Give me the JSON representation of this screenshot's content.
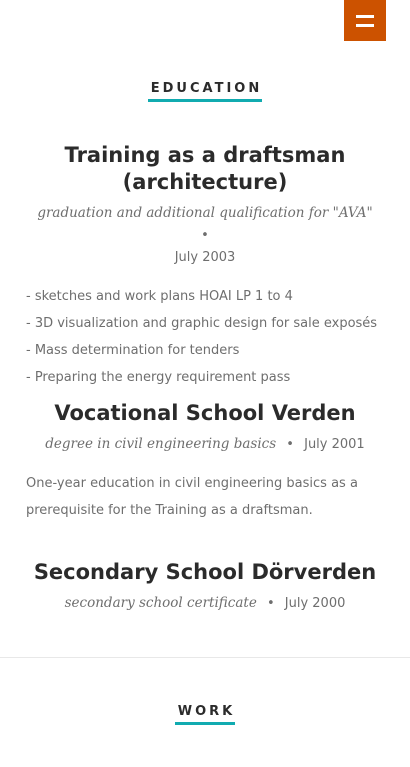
{
  "education": {
    "heading": "EDUCATION",
    "items": [
      {
        "title": "Training as a draftsman (architecture)",
        "qualification": "graduation and additional qualification for \"AVA\"",
        "date": "July 2003",
        "bullet": "•",
        "description": [
          "- sketches and work plans HOAI LP 1 to 4",
          "- 3D visualization and graphic design for sale exposés",
          "- Mass determination for tenders",
          "- Preparing the energy requirement pass"
        ]
      },
      {
        "title": "Vocational School Verden",
        "qualification": "degree in civil engineering basics",
        "date": "July 2001",
        "bullet": "•",
        "description_text": "One-year education in civil engineering basics as a prerequisite for the Training as a draftsman."
      },
      {
        "title": "Secondary School Dörverden",
        "qualification": "secondary school certificate",
        "date": "July 2000",
        "bullet": "•"
      }
    ]
  },
  "work": {
    "heading": "WORK"
  },
  "colors": {
    "accent": "#cc5200",
    "underline": "#11abb0",
    "heading_text": "#2b2b2b",
    "body_text": "#6e6e6e"
  },
  "icons": {
    "menu": "menu-icon"
  }
}
